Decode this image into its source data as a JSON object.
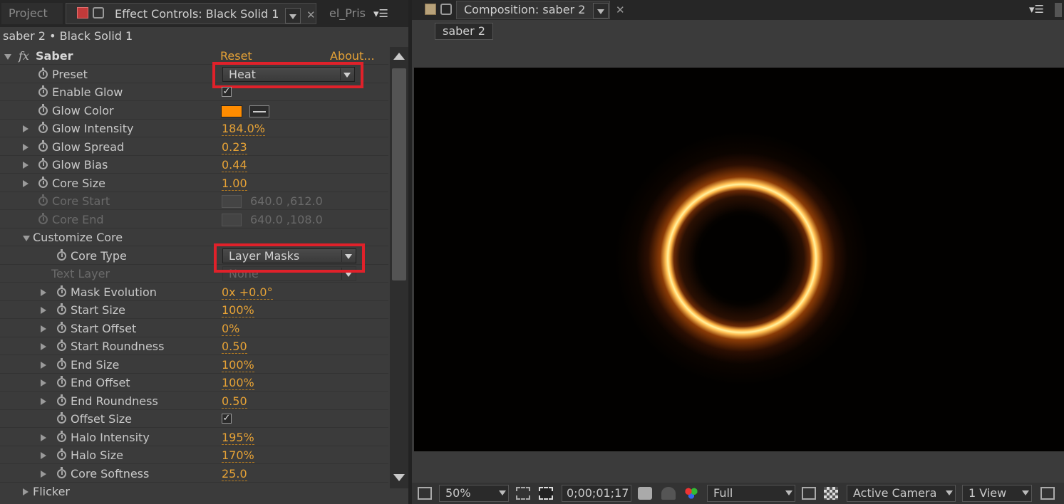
{
  "left_panel": {
    "tabs": {
      "project": "Project",
      "effect_controls": "Effect Controls: Black Solid 1",
      "other": "el_Pris"
    },
    "layer_header": "saber 2 • Black Solid 1",
    "effect": {
      "name": "Saber",
      "fx_label": "fx",
      "reset": "Reset",
      "about": "About..."
    },
    "properties": {
      "preset": {
        "label": "Preset",
        "value": "Heat"
      },
      "enable_glow": {
        "label": "Enable Glow",
        "checked": true
      },
      "glow_color": {
        "label": "Glow Color",
        "color": "#ff8c00"
      },
      "glow_intensity": {
        "label": "Glow Intensity",
        "value": "184.0%"
      },
      "glow_spread": {
        "label": "Glow Spread",
        "value": "0.23"
      },
      "glow_bias": {
        "label": "Glow Bias",
        "value": "0.44"
      },
      "core_size": {
        "label": "Core Size",
        "value": "1.00"
      },
      "core_start": {
        "label": "Core Start",
        "value": "640.0 ,612.0"
      },
      "core_end": {
        "label": "Core End",
        "value": "640.0 ,108.0"
      },
      "customize_core": {
        "label": "Customize Core"
      },
      "core_type": {
        "label": "Core Type",
        "value": "Layer Masks"
      },
      "text_layer": {
        "label": "Text Layer",
        "value": "None"
      },
      "mask_evolution": {
        "label": "Mask Evolution",
        "value": "0x +0.0°"
      },
      "start_size": {
        "label": "Start Size",
        "value": "100%"
      },
      "start_offset": {
        "label": "Start Offset",
        "value": "0%"
      },
      "start_roundness": {
        "label": "Start Roundness",
        "value": "0.50"
      },
      "end_size": {
        "label": "End Size",
        "value": "100%"
      },
      "end_offset": {
        "label": "End Offset",
        "value": "100%"
      },
      "end_roundness": {
        "label": "End Roundness",
        "value": "0.50"
      },
      "offset_size": {
        "label": "Offset Size",
        "checked": true
      },
      "halo_intensity": {
        "label": "Halo Intensity",
        "value": "195%"
      },
      "halo_size": {
        "label": "Halo Size",
        "value": "170%"
      },
      "core_softness": {
        "label": "Core Softness",
        "value": "25.0"
      },
      "flicker": {
        "label": "Flicker"
      }
    }
  },
  "right_panel": {
    "tab_title": "Composition: saber 2",
    "comp_button": "saber 2",
    "bottom_bar": {
      "zoom": "50%",
      "timecode": "0;00;01;17",
      "resolution": "Full",
      "camera": "Active Camera",
      "views": "1 View"
    }
  },
  "colors": {
    "value_orange": "#e6a236",
    "highlight_red": "#e0212a",
    "glow_color_swatch": "#ff8c00"
  }
}
